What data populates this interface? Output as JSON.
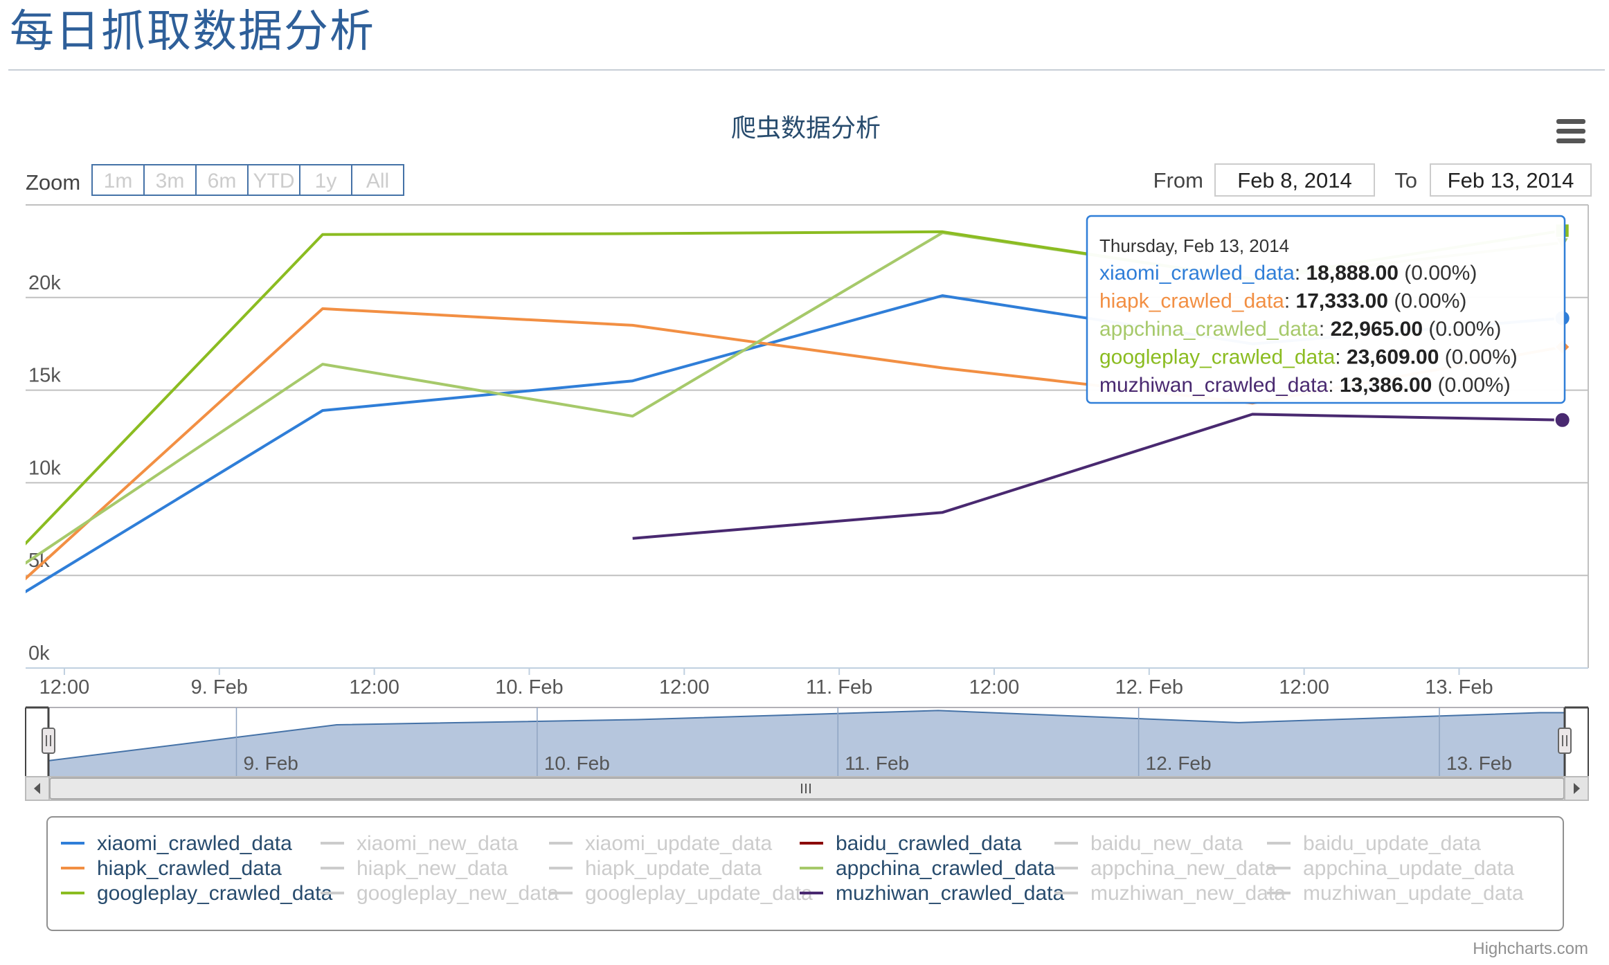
{
  "page": {
    "title": "每日抓取数据分析"
  },
  "toolbar": {
    "zoom_label": "Zoom",
    "zoom_buttons": [
      "1m",
      "3m",
      "6m",
      "YTD",
      "1y",
      "All"
    ],
    "from_label": "From",
    "to_label": "To",
    "from_value": "Feb 8, 2014",
    "to_value": "Feb 13, 2014",
    "menu_icon": "hamburger-menu-icon"
  },
  "credits": "Highcharts.com",
  "colors": {
    "xiaomi": "#2f7ed8",
    "hiapk": "#f28f43",
    "appchina": "#a6c96a",
    "googleplay": "#8bbc21",
    "muzhiwan": "#492970",
    "baidu": "#8b0000",
    "hidden": "#cccccc",
    "navigator_fill": "#b2c3db",
    "navigator_line": "#4572a7",
    "title": "#274b6d"
  },
  "chart_data": {
    "type": "line",
    "title": "爬虫数据分析",
    "xlabel": "",
    "ylabel": "",
    "ylim": [
      0,
      25000
    ],
    "xlim": [
      "2014-02-08T09:00",
      "2014-02-13T10:00"
    ],
    "y_ticks": [
      "0k",
      "5k",
      "10k",
      "15k",
      "20k"
    ],
    "x_ticks": [
      "12:00",
      "9. Feb",
      "12:00",
      "10. Feb",
      "12:00",
      "11. Feb",
      "12:00",
      "12. Feb",
      "12:00",
      "13. Feb"
    ],
    "navigator_ticks": [
      "9. Feb",
      "10. Feb",
      "11. Feb",
      "12. Feb",
      "13. Feb"
    ],
    "grid": true,
    "legend_position": "bottom",
    "series": [
      {
        "name": "xiaomi_crawled_data",
        "color": "#2f7ed8",
        "visible": true,
        "points": [
          [
            "2014-02-08T08:00",
            3700
          ],
          [
            "2014-02-09T08:00",
            13900
          ],
          [
            "2014-02-10T08:00",
            15500
          ],
          [
            "2014-02-11T08:00",
            20100
          ],
          [
            "2014-02-12T08:00",
            17500
          ],
          [
            "2014-02-13T08:00",
            18888
          ]
        ]
      },
      {
        "name": "xiaomi_new_data",
        "visible": false,
        "points": []
      },
      {
        "name": "xiaomi_update_data",
        "visible": false,
        "points": []
      },
      {
        "name": "baidu_crawled_data",
        "color": "#8b0000",
        "visible": true,
        "points": []
      },
      {
        "name": "baidu_new_data",
        "visible": false,
        "points": []
      },
      {
        "name": "baidu_update_data",
        "visible": false,
        "points": []
      },
      {
        "name": "hiapk_crawled_data",
        "color": "#f28f43",
        "visible": true,
        "points": [
          [
            "2014-02-08T08:00",
            4200
          ],
          [
            "2014-02-09T08:00",
            19400
          ],
          [
            "2014-02-10T08:00",
            18500
          ],
          [
            "2014-02-11T08:00",
            16200
          ],
          [
            "2014-02-12T08:00",
            14300
          ],
          [
            "2014-02-13T08:00",
            17333
          ]
        ]
      },
      {
        "name": "hiapk_new_data",
        "visible": false,
        "points": []
      },
      {
        "name": "hiapk_update_data",
        "visible": false,
        "points": []
      },
      {
        "name": "appchina_crawled_data",
        "color": "#a6c96a",
        "visible": true,
        "points": [
          [
            "2014-02-08T08:00",
            5200
          ],
          [
            "2014-02-09T08:00",
            16400
          ],
          [
            "2014-02-10T08:00",
            13600
          ],
          [
            "2014-02-11T08:00",
            23500
          ],
          [
            "2014-02-12T08:00",
            21000
          ],
          [
            "2014-02-13T08:00",
            22965
          ]
        ]
      },
      {
        "name": "appchina_new_data",
        "visible": false,
        "points": []
      },
      {
        "name": "appchina_update_data",
        "visible": false,
        "points": []
      },
      {
        "name": "googleplay_crawled_data",
        "color": "#8bbc21",
        "visible": true,
        "points": [
          [
            "2014-02-08T08:00",
            6000
          ],
          [
            "2014-02-09T08:00",
            23400
          ],
          [
            "2014-02-10T08:00",
            23450
          ],
          [
            "2014-02-11T08:00",
            23550
          ],
          [
            "2014-02-12T08:00",
            21000
          ],
          [
            "2014-02-13T08:00",
            23609
          ]
        ]
      },
      {
        "name": "googleplay_new_data",
        "visible": false,
        "points": []
      },
      {
        "name": "googleplay_update_data",
        "visible": false,
        "points": []
      },
      {
        "name": "muzhiwan_crawled_data",
        "color": "#492970",
        "visible": true,
        "points": [
          [
            "2014-02-10T08:00",
            7000
          ],
          [
            "2014-02-11T08:00",
            8400
          ],
          [
            "2014-02-12T08:00",
            13700
          ],
          [
            "2014-02-13T08:00",
            13386
          ]
        ]
      },
      {
        "name": "muzhiwan_new_data",
        "visible": false,
        "points": []
      },
      {
        "name": "muzhiwan_update_data",
        "visible": false,
        "points": []
      }
    ],
    "navigator_points": [
      [
        "2014-02-08T09:00",
        3700
      ],
      [
        "2014-02-09T08:00",
        12000
      ],
      [
        "2014-02-10T08:00",
        13200
      ],
      [
        "2014-02-11T08:00",
        15300
      ],
      [
        "2014-02-12T08:00",
        12500
      ],
      [
        "2014-02-13T08:00",
        14800
      ]
    ],
    "tooltip": {
      "header": "Thursday, Feb 13, 2014",
      "rows": [
        {
          "name": "xiaomi_crawled_data",
          "value": "18,888.00",
          "pct": "(0.00%)",
          "color": "#2f7ed8"
        },
        {
          "name": "hiapk_crawled_data",
          "value": "17,333.00",
          "pct": "(0.00%)",
          "color": "#f28f43"
        },
        {
          "name": "appchina_crawled_data",
          "value": "22,965.00",
          "pct": "(0.00%)",
          "color": "#a6c96a"
        },
        {
          "name": "googleplay_crawled_data",
          "value": "23,609.00",
          "pct": "(0.00%)",
          "color": "#8bbc21"
        },
        {
          "name": "muzhiwan_crawled_data",
          "value": "13,386.00",
          "pct": "(0.00%)",
          "color": "#492970"
        }
      ]
    }
  }
}
